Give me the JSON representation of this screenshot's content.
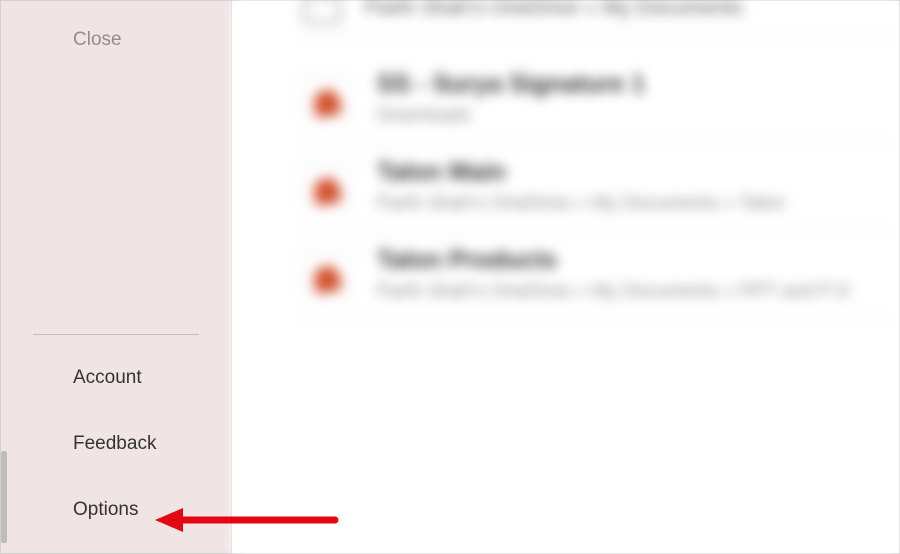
{
  "sidebar": {
    "top": {
      "close": "Close"
    },
    "bottom": {
      "account": "Account",
      "feedback": "Feedback",
      "options": "Options"
    }
  },
  "main": {
    "breadcrumb": "Parth Shah's OneDrive » My Documents",
    "files": [
      {
        "title": "SS - Surya Signature 1",
        "path": "Downloads"
      },
      {
        "title": "Talon Main",
        "path": "Parth Shah's OneDrive » My Documents » Talon"
      },
      {
        "title": "Talon Products",
        "path": "Parth Shah's OneDrive » My Documents » PPT and P D"
      }
    ]
  }
}
